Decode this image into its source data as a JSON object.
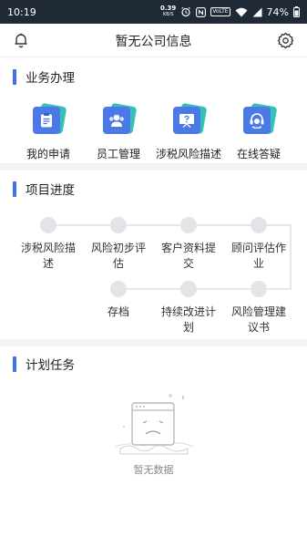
{
  "status_bar": {
    "time": "10:19",
    "net_speed_value": "0.39",
    "net_speed_unit": "KB/S",
    "volte": "VoLTE",
    "battery": "74%",
    "icons": [
      "alarm-icon",
      "nfc-icon",
      "volte-badge",
      "wifi-icon",
      "signal-icon",
      "battery-icon"
    ]
  },
  "header": {
    "title": "暂无公司信息",
    "left_icon": "bell-icon",
    "right_icon": "gear-icon"
  },
  "business": {
    "title": "业务办理",
    "items": [
      {
        "label": "我的申请",
        "icon": "clipboard-icon"
      },
      {
        "label": "员工管理",
        "icon": "people-icon"
      },
      {
        "label": "涉税风险描述",
        "icon": "question-board-icon"
      },
      {
        "label": "在线答疑",
        "icon": "headset-icon"
      }
    ]
  },
  "progress": {
    "title": "项目进度",
    "steps_row1": [
      {
        "line1": "涉税风险描",
        "line2": "述"
      },
      {
        "line1": "风险初步评",
        "line2": "估"
      },
      {
        "line1": "客户资料提",
        "line2": "交"
      },
      {
        "line1": "顾问评估作",
        "line2": "业"
      }
    ],
    "steps_row2": [
      {
        "line1": "存档",
        "line2": ""
      },
      {
        "line1": "持续改进计",
        "line2": "划"
      },
      {
        "line1": "风险管理建",
        "line2": "议书"
      }
    ]
  },
  "plan": {
    "title": "计划任务",
    "empty_text": "暂无数据",
    "empty_icon": "empty-box-icon"
  },
  "colors": {
    "accent": "#3e72e6",
    "icon_teal": "#35c2b6",
    "status_bar": "#1f2a36",
    "dot": "#e3e4e7"
  }
}
